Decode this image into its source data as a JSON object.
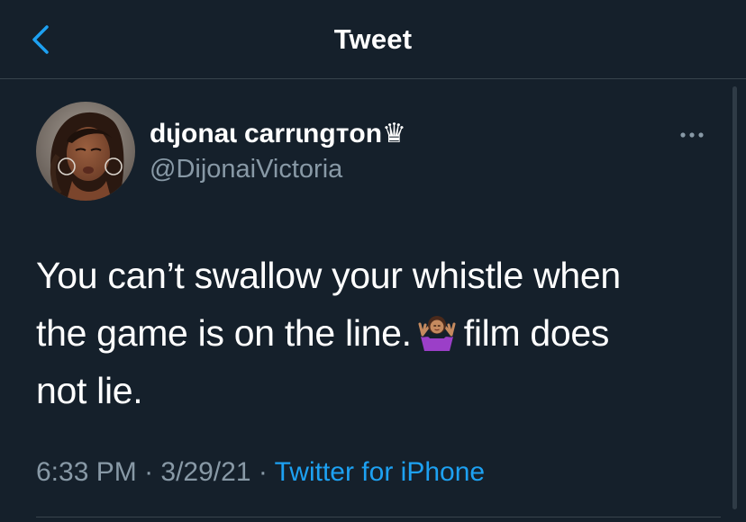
{
  "header": {
    "back_icon": "chevron-left-icon",
    "title": "Tweet"
  },
  "author": {
    "avatar_icon": "profile-photo",
    "display_name": "dɩjonaɩ carrɩngтon♛",
    "handle": "@DijonaiVictoria"
  },
  "more_icon": "ellipsis-icon",
  "tweet": {
    "lines": [
      {
        "text": "You can’t swallow your whistle when"
      },
      {
        "before": "the game is on the line.",
        "emoji": "person-shrugging-emoji",
        "after": "film does"
      },
      {
        "text": "not lie."
      }
    ]
  },
  "meta": {
    "time": "6:33 PM",
    "separator": " · ",
    "date": "3/29/21",
    "source": "Twitter for iPhone"
  },
  "colors": {
    "background": "#15202b",
    "secondary_text": "#8899a6",
    "accent": "#1da1f2",
    "divider": "#38444d"
  }
}
